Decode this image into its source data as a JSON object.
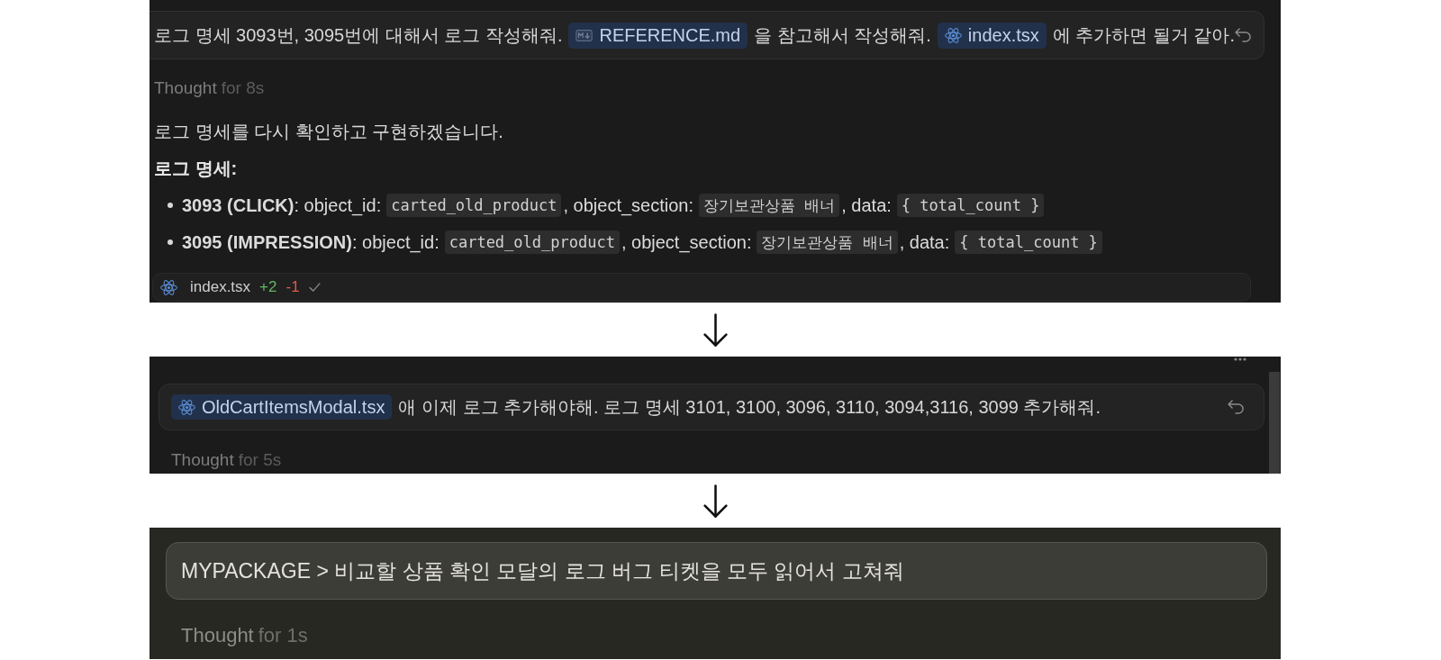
{
  "panels": [
    {
      "kind": "cropped",
      "message": [
        {
          "kind": "text",
          "text": "로그 명세 3093번, 3095번에 대해서 로그 작성해줘."
        },
        {
          "kind": "markdown",
          "text": "REFERENCE.md"
        },
        {
          "kind": "text",
          "text": "을 참고해서 작성해줘."
        },
        {
          "kind": "tsx",
          "text": "index.tsx"
        },
        {
          "kind": "text",
          "text": "에 추가하면 될거 같아."
        }
      ],
      "thought": {
        "label": "Thought",
        "duration": "for 8s"
      },
      "response": [
        {
          "kind": "paragraph",
          "parts": [
            {
              "kind": "text",
              "text": "로그 명세를 다시 확인하고 구현하겠습니다."
            }
          ]
        },
        {
          "kind": "heading",
          "parts": [
            {
              "kind": "text",
              "text": "로그 명세:"
            }
          ]
        },
        {
          "kind": "bullet",
          "parts": [
            {
              "kind": "text",
              "text": "**3093 (CLICK)**: object_id:"
            },
            {
              "kind": "code",
              "text": "carted_old_product"
            },
            {
              "kind": "text",
              "text": ", object_section:"
            },
            {
              "kind": "code",
              "text": "장기보관상품 배너"
            },
            {
              "kind": "text",
              "text": ", data:"
            },
            {
              "kind": "code",
              "text": "{ total_count }"
            }
          ]
        },
        {
          "kind": "bullet",
          "parts": [
            {
              "kind": "text",
              "text": "**3095 (IMPRESSION)**: object_id:"
            },
            {
              "kind": "code",
              "text": "carted_old_product"
            },
            {
              "kind": "text",
              "text": ", object_section:"
            },
            {
              "kind": "code",
              "text": "장기보관상품 배너"
            },
            {
              "kind": "text",
              "text": ", data:"
            },
            {
              "kind": "code",
              "text": "{ total_count }"
            }
          ]
        }
      ],
      "file_change": {
        "name": "index.tsx",
        "added": "+2",
        "removed": "-1"
      }
    },
    {
      "kind": "scrolled",
      "message": [
        {
          "kind": "tsx",
          "text": "OldCartItemsModal.tsx"
        },
        {
          "kind": "text",
          "text": "애 이제 로그 추가해야해. 로그 명세 3101, 3100, 3096, 3110, 3094,3116, 3099 추가해줘."
        }
      ],
      "thought": {
        "label": "Thought",
        "duration": "for 5s"
      }
    },
    {
      "kind": "composer",
      "message": [
        {
          "kind": "text",
          "text": "MYPACKAGE > 비교할 상품 확인 모달의 로그 버그 티켓을 모두 읽어서 고쳐줘"
        }
      ],
      "thought": {
        "label": "Thought",
        "duration": "for 1s"
      }
    }
  ]
}
